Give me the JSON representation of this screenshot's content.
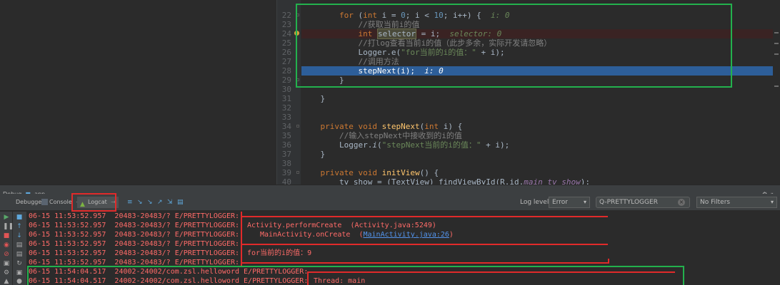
{
  "editor": {
    "gutter_lines": [
      "22",
      "23",
      "24",
      "25",
      "26",
      "27",
      "28",
      "29",
      "30",
      "31",
      "32",
      "33",
      "34",
      "35",
      "36",
      "37",
      "38",
      "39",
      "40"
    ],
    "code": {
      "l22": {
        "kw_for": "for",
        "kw_int": "int",
        "rest1": " i = ",
        "n0": "0",
        "rest2": "; i < ",
        "n10": "10",
        "rest3": "; i++) {",
        "hint": "  i: 0"
      },
      "l23": "//获取当前i的值",
      "l24": {
        "kw_int": "int",
        "sel": "selector",
        "rest": " = i;",
        "hint": "  selector: 0"
      },
      "l25": "//打log查看当前i的值（此步多余，实际开发请忽略）",
      "l26": {
        "pre": "Logger.",
        "mth": "e",
        "open": "(",
        "str": "\"for当前的i的值：\"",
        "rest": " + i);"
      },
      "l27": "//调用方法",
      "l28": {
        "code": "stepNext(i);",
        "hint": "  i: 0"
      },
      "l29": "}",
      "l31": "}",
      "l34": {
        "kw1": "private",
        "kw2": "void",
        "mth": "stepNext",
        "open": "(",
        "kw3": "int",
        "rest": " i) {"
      },
      "l35": "//输入stepNext中接收到的i的值",
      "l36": {
        "pre": "Logger.",
        "mth": "i",
        "open": "(",
        "str": "\"stepNext当前的i的值：\"",
        "rest": " + i);"
      },
      "l37": "}",
      "l39": {
        "kw1": "private",
        "kw2": "void",
        "mth": "initView",
        "rest": "() {"
      },
      "l40": {
        "pre": "tv_show = (TextView) findViewById(R.id.",
        "fld": "main_tv_show",
        "rest": ");"
      }
    }
  },
  "debug": {
    "title": "Debug",
    "app": "app",
    "tabs": {
      "debugger": "Debugger",
      "console": "Console",
      "logcat": "Logcat"
    },
    "log_level_label": "Log level:",
    "log_level_value": "Error",
    "search_value": "Q-PRETTYLOGGER",
    "filter_value": "No Filters"
  },
  "logs": [
    {
      "ts": "06-15 11:53:52.957",
      "pid": "20483-20483/? E/PRETTYLOGGER:"
    },
    {
      "ts": "06-15 11:53:52.957",
      "pid": "20483-20483/? E/PRETTYLOGGER:"
    },
    {
      "ts": "06-15 11:53:52.957",
      "pid": "20483-20483/? E/PRETTYLOGGER:"
    },
    {
      "ts": "06-15 11:53:52.957",
      "pid": "20483-20483/? E/PRETTYLOGGER:"
    },
    {
      "ts": "06-15 11:53:52.957",
      "pid": "20483-20483/? E/PRETTYLOGGER:"
    },
    {
      "ts": "06-15 11:53:52.957",
      "pid": "20483-20483/? E/PRETTYLOGGER:"
    },
    {
      "ts": "06-15 11:54:04.517",
      "pid": "24002-24002/com.zsl.helloword E/PRETTYLOGGER:"
    },
    {
      "ts": "06-15 11:54:04.517",
      "pid": "24002-24002/com.zsl.helloword E/PRETTYLOGGER:"
    }
  ],
  "log_messages": {
    "m1": "Activity.performCreate  (Activity.java:5249)",
    "m2_pre": "MainActivity.onCreate  (",
    "m2_link": "MainActivity.java:26",
    "m2_post": ")",
    "m3": "for当前的i的值：9",
    "m4": "Thread: main"
  },
  "colors": {
    "log_error": "#ff6b68",
    "highlight_box_green": "#23b14d",
    "highlight_box_red": "#e12a2a",
    "exec_line": "#2d5e99"
  }
}
